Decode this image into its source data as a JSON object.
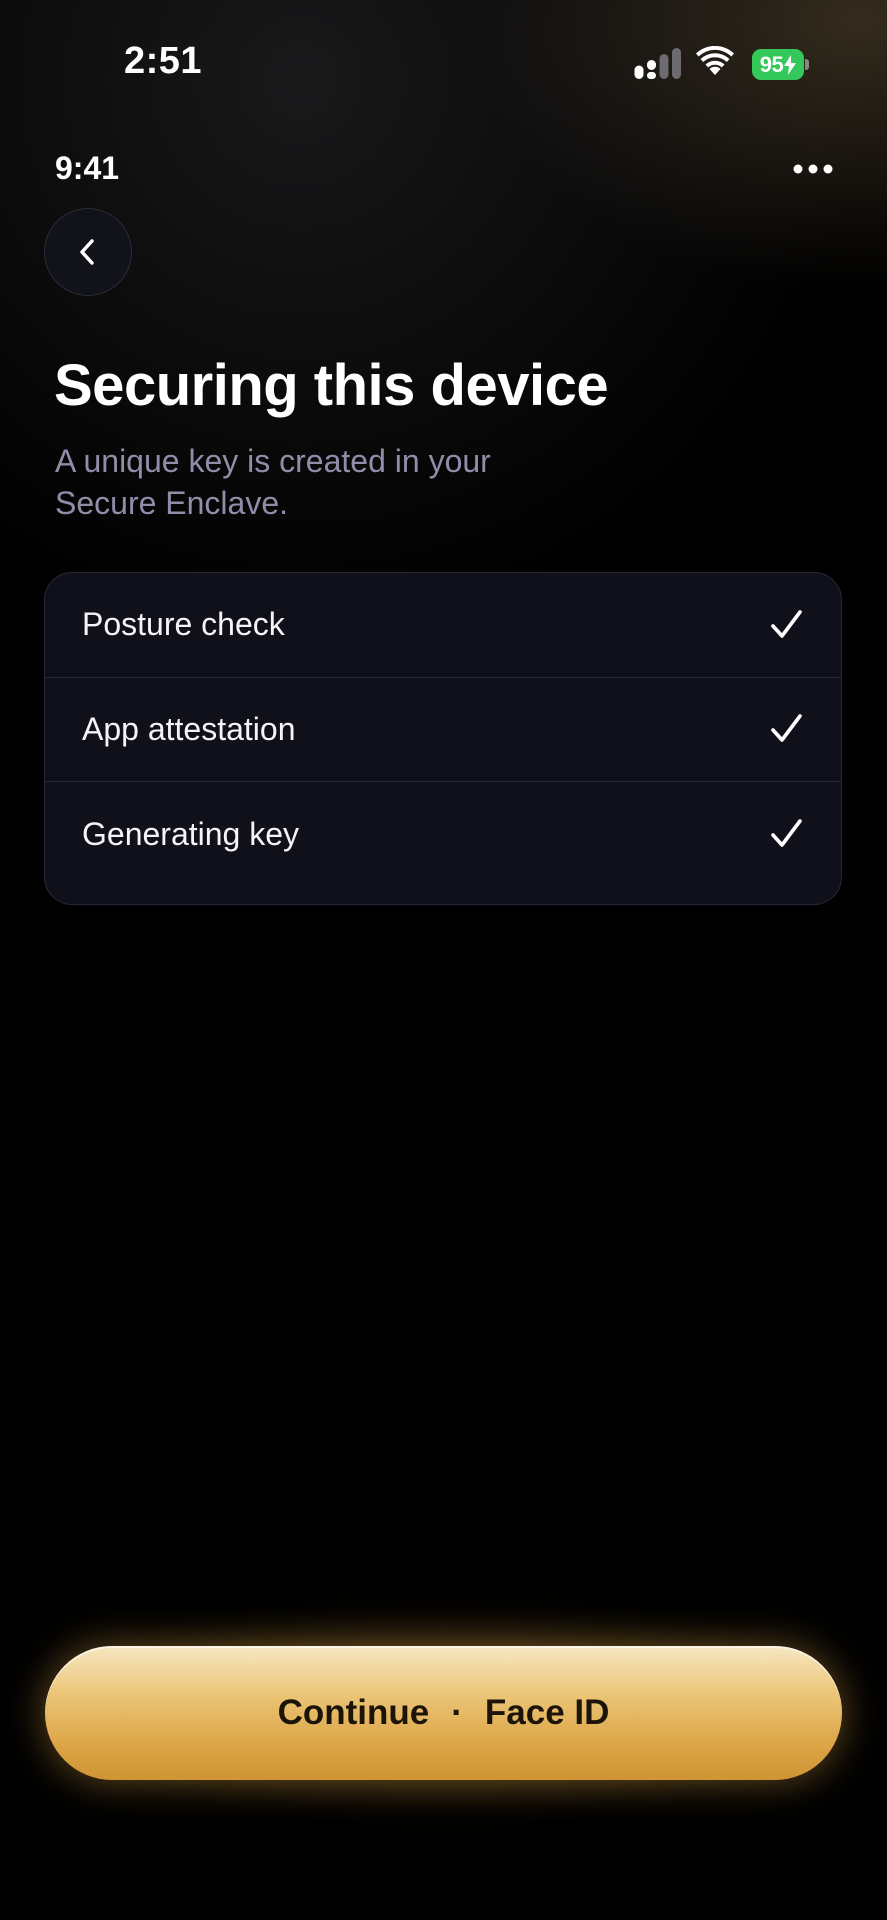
{
  "status_bar": {
    "time": "2:51",
    "battery_level": "95",
    "battery_color": "#34c759"
  },
  "header": {
    "time": "9:41",
    "more_icon": "ellipsis-icon",
    "back_icon": "chevron-left-icon"
  },
  "content": {
    "title": "Securing this device",
    "subtitle": "A unique key is created in your Secure Enclave."
  },
  "checklist": {
    "items": [
      {
        "label": "Posture check",
        "status": "done",
        "icon": "checkmark-icon"
      },
      {
        "label": "App attestation",
        "status": "done",
        "icon": "checkmark-icon"
      },
      {
        "label": "Generating key",
        "status": "done",
        "icon": "checkmark-icon"
      }
    ]
  },
  "continue_button": {
    "label": "Continue",
    "separator": "·",
    "method": "Face ID",
    "accent_color": "#dca445"
  }
}
